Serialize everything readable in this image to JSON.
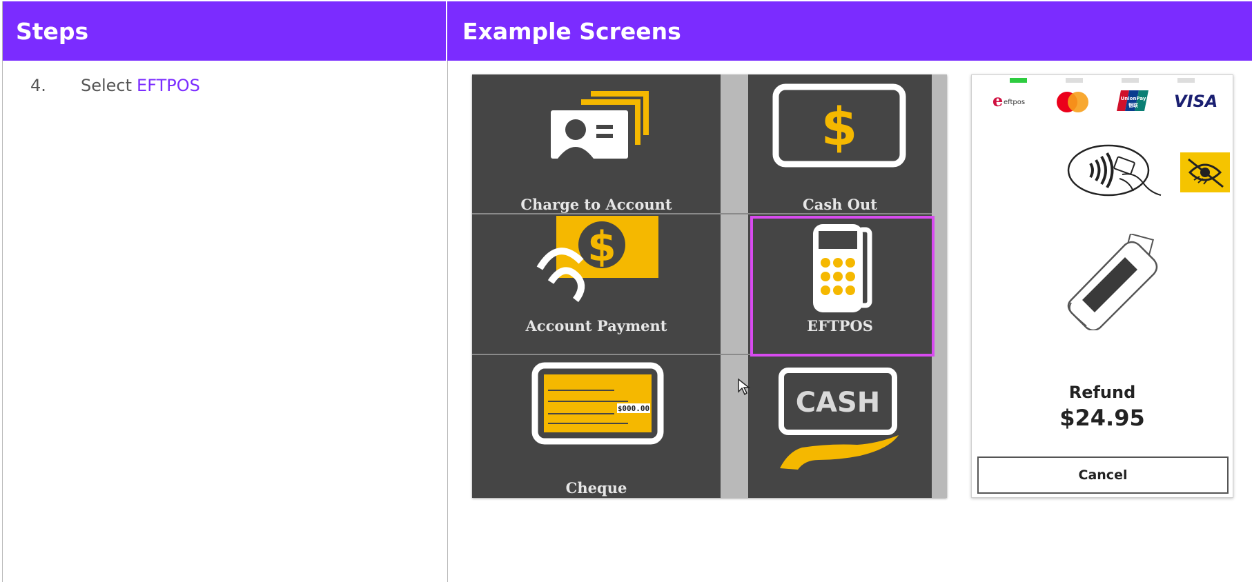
{
  "header": {
    "steps_title": "Steps",
    "examples_title": "Example Screens"
  },
  "step": {
    "number": "4.",
    "text": "Select",
    "link": "EFTPOS"
  },
  "pos_screen": {
    "tiles": [
      {
        "label": "Charge to Account",
        "icon": "charge-to-account-icon"
      },
      {
        "label": "Cash Out",
        "icon": "dollar-note-icon"
      },
      {
        "label": "Account Payment",
        "icon": "account-payment-icon"
      },
      {
        "label": "EFTPOS",
        "icon": "eftpos-terminal-icon",
        "selected": true
      },
      {
        "label": "Cheque",
        "icon": "cheque-icon",
        "cheque_amount": "$000.00"
      },
      {
        "label": "",
        "icon": "cash-hand-icon",
        "cash_text": "CASH"
      }
    ]
  },
  "terminal": {
    "card_brands": {
      "eftpos": "eftpos",
      "unionpay_top": "UnionPay",
      "unionpay_bottom": "银联",
      "visa": "VISA"
    },
    "refund_label": "Refund",
    "refund_amount": "$24.95",
    "cancel_label": "Cancel"
  },
  "colors": {
    "header_bg": "#7b2cff",
    "link": "#7b2cff",
    "tile_bg": "#454545",
    "accent_yellow": "#f5b800",
    "highlight": "#d84bf0",
    "status_active": "#2ecc40"
  }
}
